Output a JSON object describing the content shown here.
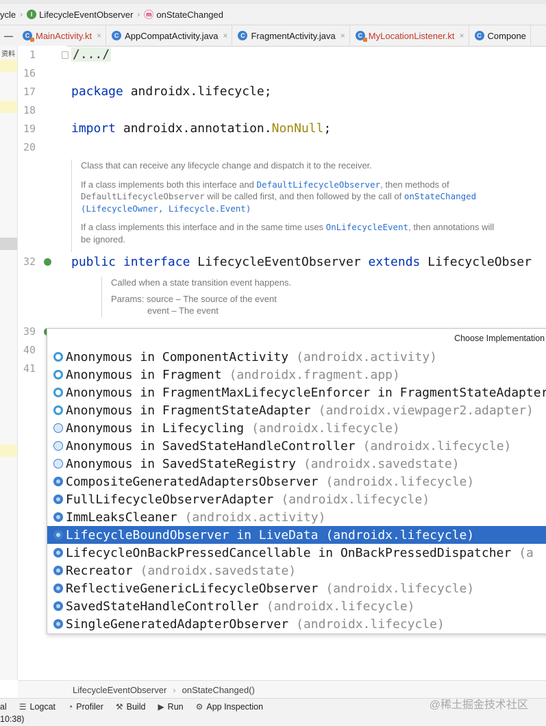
{
  "breadcrumb": {
    "items": [
      {
        "label": "ycle",
        "icon": ""
      },
      {
        "label": "LifecycleEventObserver",
        "icon": "interface-icon",
        "glyph": "I"
      },
      {
        "label": "onStateChanged",
        "icon": "method-icon",
        "glyph": "m"
      }
    ]
  },
  "tabs": [
    {
      "label": "MainActivity.kt",
      "kotlin": true
    },
    {
      "label": "AppCompatActivity.java",
      "kotlin": false
    },
    {
      "label": "FragmentActivity.java",
      "kotlin": false
    },
    {
      "label": "MyLocationListener.kt",
      "kotlin": true
    },
    {
      "label": "Compone",
      "kotlin": false
    }
  ],
  "icons": {
    "tab_class": "C",
    "close": "×",
    "collapse": "—"
  },
  "left_strip": {
    "label": "资料"
  },
  "gutter": {
    "line_numbers": [
      "1",
      "16",
      "17",
      "18",
      "19",
      "20",
      "32",
      "39",
      "40",
      "41"
    ]
  },
  "code": {
    "line1": "/.../",
    "line17_kw": "package",
    "line17_rest": " androidx.lifecycle;",
    "line19_kw": "import",
    "line19_mid": " androidx.annotation.",
    "line19_ann": "NonNull",
    "line19_end": ";",
    "line32_kw1": "public",
    "line32_kw2": "interface",
    "line32_name": "LifecycleEventObserver",
    "line32_kw3": "extends",
    "line32_super": "LifecycleObser"
  },
  "doc_interface": {
    "p1": "Class that can receive any lifecycle change and dispatch it to the receiver.",
    "p2_a": "If a class implements both this interface and ",
    "p2_link1": "DefaultLifecycleObserver",
    "p2_b": ", then methods of",
    "p2_code1": "DefaultLifecycleObserver",
    "p2_c": " will be called first, and then followed by the call of ",
    "p2_link2": "onStateChanged",
    "p2_link3": "(LifecycleOwner, Lifecycle.Event)",
    "p3_a": "If a class implements this interface and in the same time uses ",
    "p3_link": "OnLifecycleEvent",
    "p3_b": ", then annotations will",
    "p3_c": "be ignored."
  },
  "doc_method": {
    "line1": "Called when a state transition event happens.",
    "line2": "Params: source – The source of the event",
    "line3": "event – The event"
  },
  "popup": {
    "title": "Choose Implementation of",
    "items": [
      {
        "name": "Anonymous in ComponentActivity",
        "pkg": "(androidx.activity)",
        "icon": "anonymous-class-icon",
        "kind": "anon"
      },
      {
        "name": "Anonymous in Fragment",
        "pkg": "(androidx.fragment.app)",
        "icon": "anonymous-class-icon",
        "kind": "anon"
      },
      {
        "name": "Anonymous in FragmentMaxLifecycleEnforcer in FragmentStateAdapter",
        "pkg": "",
        "icon": "anonymous-class-icon",
        "kind": "anon"
      },
      {
        "name": "Anonymous in FragmentStateAdapter",
        "pkg": "(androidx.viewpager2.adapter)",
        "icon": "anonymous-class-icon",
        "kind": "anon"
      },
      {
        "name": "Anonymous in Lifecycling",
        "pkg": "(androidx.lifecycle)",
        "icon": "lambda-icon",
        "kind": "lambda"
      },
      {
        "name": "Anonymous in SavedStateHandleController",
        "pkg": "(androidx.lifecycle)",
        "icon": "lambda-icon",
        "kind": "lambda"
      },
      {
        "name": "Anonymous in SavedStateRegistry",
        "pkg": "(androidx.savedstate)",
        "icon": "lambda-icon",
        "kind": "lambda"
      },
      {
        "name": "CompositeGeneratedAdaptersObserver",
        "pkg": "(androidx.lifecycle)",
        "icon": "class-icon",
        "kind": "cls"
      },
      {
        "name": "FullLifecycleObserverAdapter",
        "pkg": "(androidx.lifecycle)",
        "icon": "class-icon",
        "kind": "cls"
      },
      {
        "name": "ImmLeaksCleaner",
        "pkg": "(androidx.activity)",
        "icon": "class-icon",
        "kind": "cls"
      },
      {
        "name": "LifecycleBoundObserver in LiveData",
        "pkg": "(androidx.lifecycle)",
        "icon": "class-icon",
        "kind": "cls",
        "selected": true
      },
      {
        "name": "LifecycleOnBackPressedCancellable in OnBackPressedDispatcher",
        "pkg": "(a",
        "icon": "class-icon",
        "kind": "cls"
      },
      {
        "name": "Recreator",
        "pkg": "(androidx.savedstate)",
        "icon": "class-icon",
        "kind": "cls"
      },
      {
        "name": "ReflectiveGenericLifecycleObserver",
        "pkg": "(androidx.lifecycle)",
        "icon": "class-icon",
        "kind": "cls"
      },
      {
        "name": "SavedStateHandleController",
        "pkg": "(androidx.lifecycle)",
        "icon": "class-icon",
        "kind": "cls"
      },
      {
        "name": "SingleGeneratedAdapterObserver",
        "pkg": "(androidx.lifecycle)",
        "icon": "class-icon",
        "kind": "cls"
      }
    ]
  },
  "bottom_breadcrumb": {
    "item1": "LifecycleEventObserver",
    "item2": "onStateChanged()",
    "sep": "›"
  },
  "tool_bar": {
    "items": [
      {
        "label": "al",
        "glyph": ""
      },
      {
        "label": "Logcat",
        "glyph": "☰"
      },
      {
        "label": "Profiler",
        "glyph": "◔"
      },
      {
        "label": "Build",
        "glyph": "⚒"
      },
      {
        "label": "Run",
        "glyph": "▶"
      },
      {
        "label": "App Inspection",
        "glyph": "⚙"
      }
    ]
  },
  "watermark": "@稀土掘金技术社区",
  "status": {
    "text": "10:38)"
  }
}
